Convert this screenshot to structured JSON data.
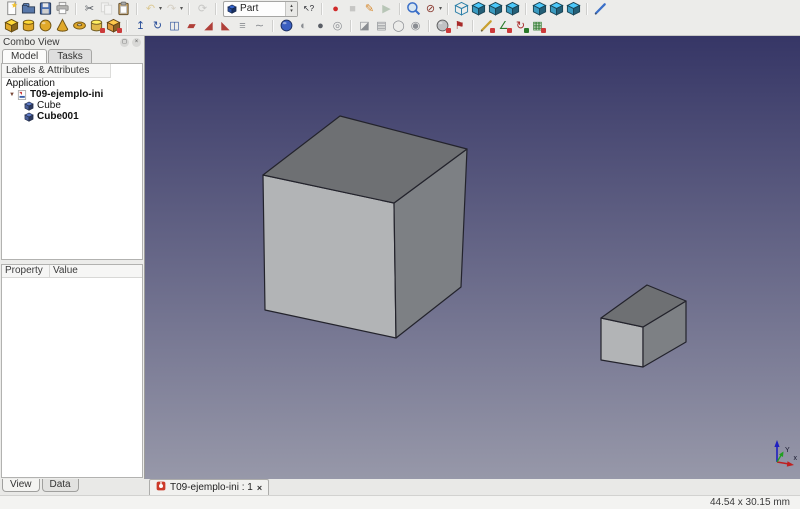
{
  "toolbars": {
    "row1": [
      {
        "name": "new-file",
        "shape": "page",
        "color": "#f2c230"
      },
      {
        "name": "open-file",
        "shape": "folder",
        "color": "#5878aa"
      },
      {
        "name": "save-file",
        "shape": "save",
        "color": "#4a6fb0"
      },
      {
        "name": "print",
        "shape": "printer",
        "color": "#9a9a9a"
      },
      {
        "sep": true
      },
      {
        "name": "cut",
        "shape": "glyph",
        "glyph": "✂",
        "color": "#4a4f57"
      },
      {
        "name": "copy",
        "shape": "copy",
        "color": "#bbbbbb",
        "disabled": true
      },
      {
        "name": "paste",
        "shape": "clip",
        "color": "#c9a260"
      },
      {
        "sep": true
      },
      {
        "name": "undo",
        "shape": "glyph",
        "glyph": "↶",
        "color": "#c9a030",
        "disabled": true,
        "dd": true
      },
      {
        "name": "redo",
        "shape": "glyph",
        "glyph": "↷",
        "color": "#b8ad96",
        "disabled": true,
        "dd": true
      },
      {
        "sep": true
      },
      {
        "name": "refresh",
        "shape": "glyph",
        "glyph": "⟳",
        "color": "#9a9a98",
        "disabled": true
      },
      {
        "sep": true
      },
      {
        "name": "workbench-selector",
        "combo": true,
        "value": "Part",
        "icon_color": "#2a4fa0"
      },
      {
        "name": "whats-this",
        "shape": "glyph",
        "glyph": "↖?",
        "color": "#23242a"
      },
      {
        "sep": true
      },
      {
        "name": "macro-record",
        "shape": "glyph",
        "glyph": "●",
        "color": "#d02a2a"
      },
      {
        "name": "macro-stop",
        "shape": "glyph",
        "glyph": "■",
        "color": "#9a9a98",
        "disabled": true
      },
      {
        "name": "macro-edit",
        "shape": "glyph",
        "glyph": "✎",
        "color": "#d7872a"
      },
      {
        "name": "macro-play",
        "shape": "glyph",
        "glyph": "▶",
        "color": "#7a9a7a",
        "disabled": true
      },
      {
        "sep": true
      },
      {
        "name": "zoom-fit-all",
        "shape": "mag",
        "color": "#3a6fc8"
      },
      {
        "name": "draw-style",
        "shape": "glyph",
        "glyph": "⊘",
        "color": "#8a3a30",
        "dd": true
      },
      {
        "sep": true
      },
      {
        "name": "view-axonometric",
        "shape": "wirecube",
        "color": "#2a7fa8"
      },
      {
        "name": "view-front",
        "shape": "cube",
        "color": "#3a9ac0"
      },
      {
        "name": "view-top",
        "shape": "cube",
        "color": "#3a9ac0"
      },
      {
        "name": "view-right",
        "shape": "cube",
        "color": "#3a9ac0"
      },
      {
        "sep": true
      },
      {
        "name": "view-rear",
        "shape": "cube",
        "color": "#3a9ac0"
      },
      {
        "name": "view-bottom",
        "shape": "cube",
        "color": "#3a9ac0"
      },
      {
        "name": "view-left",
        "shape": "cube",
        "color": "#3a9ac0"
      },
      {
        "sep": true
      },
      {
        "name": "measure-distance",
        "shape": "pen",
        "color": "#3a6fc8"
      }
    ],
    "row2": [
      {
        "name": "part-box",
        "shape": "cube",
        "color": "#e0a82a"
      },
      {
        "name": "part-cylinder",
        "shape": "cyl",
        "color": "#e0a82a"
      },
      {
        "name": "part-sphere",
        "shape": "sphere",
        "color": "#e0a82a"
      },
      {
        "name": "part-cone",
        "shape": "cone",
        "color": "#e0a82a"
      },
      {
        "name": "part-torus",
        "shape": "torus",
        "color": "#e0a82a"
      },
      {
        "name": "part-primitives",
        "shape": "cyl",
        "color": "#e0b84a",
        "dot": "#cc3a3a"
      },
      {
        "name": "part-shape-builder",
        "shape": "cube",
        "color": "#e09a3a",
        "dot": "#cc3a3a"
      },
      {
        "sep": true
      },
      {
        "name": "part-extrude",
        "shape": "glyph",
        "glyph": "↥",
        "color": "#2a4f9a"
      },
      {
        "name": "part-revolve",
        "shape": "glyph",
        "glyph": "↻",
        "color": "#2a4f9a"
      },
      {
        "name": "part-mirror",
        "shape": "glyph",
        "glyph": "◫",
        "color": "#2a4f9a"
      },
      {
        "name": "part-fillet",
        "shape": "glyph",
        "glyph": "▰",
        "color": "#b0403a"
      },
      {
        "name": "part-chamfer",
        "shape": "glyph",
        "glyph": "◢",
        "color": "#b0403a"
      },
      {
        "name": "part-ruled-surface",
        "shape": "glyph",
        "glyph": "◣",
        "color": "#b0403a"
      },
      {
        "name": "part-loft",
        "shape": "glyph",
        "glyph": "≡",
        "color": "#8a8d92"
      },
      {
        "name": "part-sweep",
        "shape": "glyph",
        "glyph": "∼",
        "color": "#8a8d92"
      },
      {
        "sep": true
      },
      {
        "name": "part-boolean",
        "shape": "sphere",
        "color": "#3a5fc0"
      },
      {
        "name": "part-cut",
        "shape": "glyph",
        "glyph": "◐",
        "color": "#8a8d92"
      },
      {
        "name": "part-union",
        "shape": "glyph",
        "glyph": "●",
        "color": "#5a5e66"
      },
      {
        "name": "part-common",
        "shape": "glyph",
        "glyph": "◎",
        "color": "#8a8d92"
      },
      {
        "sep": true
      },
      {
        "name": "part-section",
        "shape": "glyph",
        "glyph": "◪",
        "color": "#8a8d92"
      },
      {
        "name": "part-cross-sections",
        "shape": "glyph",
        "glyph": "▤",
        "color": "#8a8d92"
      },
      {
        "name": "part-offset",
        "shape": "glyph",
        "glyph": "◯",
        "color": "#8a8d92"
      },
      {
        "name": "part-thickness",
        "shape": "glyph",
        "glyph": "◉",
        "color": "#8a8d92"
      },
      {
        "sep": true
      },
      {
        "name": "part-check-geometry",
        "shape": "sphere",
        "color": "#c0c2c4",
        "dot": "#cc3a3a"
      },
      {
        "name": "part-defeaturing",
        "shape": "glyph",
        "glyph": "⚑",
        "color": "#a82a2a"
      },
      {
        "sep": true
      },
      {
        "name": "measure-linear",
        "shape": "pen",
        "color": "#c9a030",
        "dot": "#cc3a3a"
      },
      {
        "name": "measure-angular",
        "shape": "glyph",
        "glyph": "∠",
        "color": "#2a7a2a",
        "dot": "#cc3a3a"
      },
      {
        "name": "measure-refresh",
        "shape": "glyph",
        "glyph": "↻",
        "color": "#a82a2a",
        "dot": "#2a7a2a"
      },
      {
        "name": "measure-toggle-all",
        "shape": "glyph",
        "glyph": "▦",
        "color": "#2a7a2a",
        "dot": "#cc3a3a"
      }
    ]
  },
  "combo_view": {
    "title": "Combo View",
    "float_button": "◻",
    "close_button": "×",
    "tabs": [
      {
        "label": "Model",
        "active": true
      },
      {
        "label": "Tasks",
        "active": false
      }
    ],
    "tree_header": "Labels & Attributes",
    "tree": [
      {
        "label": "Application",
        "icon": null,
        "bold": false,
        "indent": 4
      },
      {
        "label": "T09-ejemplo-ini",
        "icon": "doc",
        "bold": true,
        "indent": 7,
        "expander": true
      },
      {
        "label": "Cube",
        "icon": "cube",
        "bold": false,
        "indent": 22
      },
      {
        "label": "Cube001",
        "icon": "cube",
        "bold": true,
        "indent": 22
      }
    ],
    "property_table": {
      "columns": [
        "Property",
        "Value"
      ]
    },
    "bottom_tabs": [
      {
        "label": "View",
        "active": true
      },
      {
        "label": "Data",
        "active": false
      }
    ]
  },
  "viewport": {
    "bg_top": "#363666",
    "bg_bottom": "#9798a9",
    "edge_color": "#23232c",
    "face_colors": {
      "top": "#6e7073",
      "left": "#b2b4b6",
      "right": "#7d8084"
    },
    "objects": [
      {
        "name": "Cube",
        "top": "263,175 340,116 467,149 394,203",
        "left": "263,175 394,203 396,338 265,310",
        "right": "394,203 467,149 461,287 396,338"
      },
      {
        "name": "Cube001",
        "top": "601,318 647,285 686,301 643,327",
        "left": "601,318 643,327 643,367 601,360",
        "right": "643,327 686,301 686,342 643,367"
      }
    ],
    "axis": {
      "labels": {
        "x": "x",
        "y": "Y"
      },
      "colors": {
        "x": "#c02020",
        "y": "#20a020",
        "z": "#2020c0"
      }
    }
  },
  "mdi": {
    "tab_label": "T09-ejemplo-ini : 1",
    "close_glyph": "×"
  },
  "status_bar": {
    "dimensions": "44.54 x 30.15 mm"
  }
}
